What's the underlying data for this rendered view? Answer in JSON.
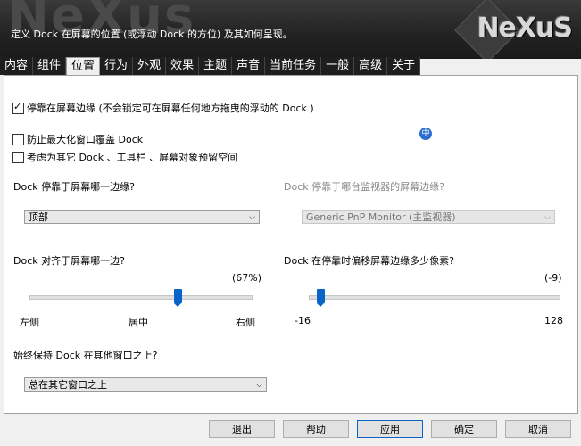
{
  "header": {
    "bg_word": "NeXus",
    "subtitle": "定义 Dock 在屏幕的位置 (或浮动 Dock 的方位) 及其如何呈现。",
    "logo": "NeXuS"
  },
  "tabs": [
    {
      "label": "内容",
      "active": false
    },
    {
      "label": "组件",
      "active": false
    },
    {
      "label": "位置",
      "active": true
    },
    {
      "label": "行为",
      "active": false
    },
    {
      "label": "外观",
      "active": false
    },
    {
      "label": "效果",
      "active": false
    },
    {
      "label": "主题",
      "active": false
    },
    {
      "label": "声音",
      "active": false
    },
    {
      "label": "当前任务",
      "active": false
    },
    {
      "label": "一般",
      "active": false
    },
    {
      "label": "高级",
      "active": false
    },
    {
      "label": "关于",
      "active": false
    }
  ],
  "options": {
    "dock_edge": {
      "label": "停靠在屏幕边缘 (不会锁定可在屏幕任何地方拖曳的浮动的 Dock )",
      "checked": true
    },
    "prevent_max": {
      "label": "防止最大化窗口覆盖 Dock",
      "checked": false
    },
    "reserve_space": {
      "label": "考虑为其它 Dock 、工具栏 、屏幕对象预留空间",
      "checked": false
    }
  },
  "help_icon": "中",
  "edge": {
    "label": "Dock 停靠于屏幕哪一边缘?",
    "value": "顶部"
  },
  "monitor": {
    "label": "Dock 停靠于哪台监视器的屏幕边缘?",
    "value": "Generic PnP Monitor (主监视器)"
  },
  "align": {
    "label": "Dock 对齐于屏幕哪一边?",
    "value_text": "(67%)",
    "value": 0.67,
    "left": "左侧",
    "center": "居中",
    "right": "右侧"
  },
  "offset": {
    "label": "Dock 在停靠时偏移屏幕边缘多少像素?",
    "value_text": "(-9)",
    "value": -9,
    "min_label": "-16",
    "max_label": "128",
    "min": -16,
    "max": 128
  },
  "ontop": {
    "label": "始终保持 Dock 在其他窗口之上?",
    "value": "总在其它窗口之上"
  },
  "buttons": {
    "exit": "退出",
    "help": "帮助",
    "apply": "应用",
    "ok": "确定",
    "cancel": "取消"
  }
}
